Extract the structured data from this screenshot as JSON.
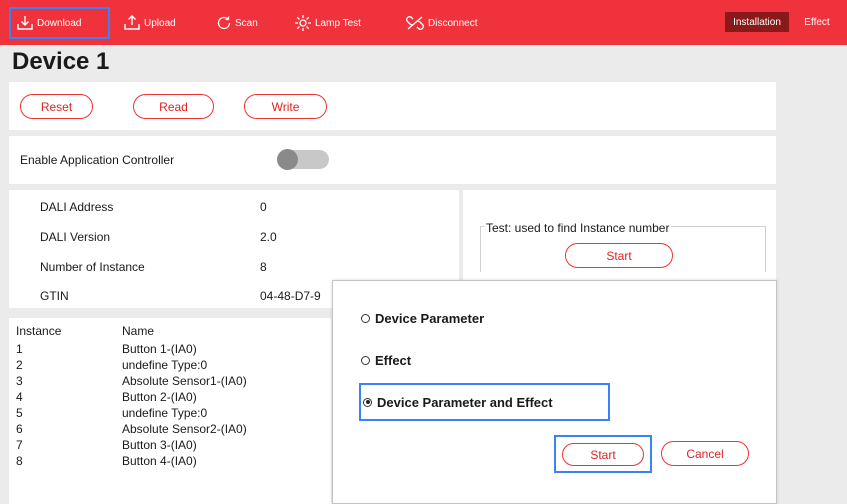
{
  "toolbar": {
    "download": "Download",
    "upload": "Upload",
    "scan": "Scan",
    "lamp_test": "Lamp Test",
    "disconnect": "Disconnect",
    "tabs": {
      "installation": "Installation",
      "effect": "Effect"
    },
    "active_tab": "Installation",
    "accent_color": "#f0323c"
  },
  "page": {
    "title": "Device 1"
  },
  "actions": {
    "reset": "Reset",
    "read": "Read",
    "write": "Write"
  },
  "controller": {
    "label": "Enable Application Controller",
    "enabled": false
  },
  "info": {
    "dali_address_label": "DALI Address",
    "dali_address": "0",
    "dali_version_label": "DALI Version",
    "dali_version": "2.0",
    "instances_label": "Number of Instance",
    "instances": "8",
    "gtin_label": "GTIN",
    "gtin": "04-48-D7-9"
  },
  "test": {
    "legend": "Test: used to find Instance number",
    "start": "Start"
  },
  "instances": {
    "headers": {
      "index": "Instance",
      "name": "Name"
    },
    "rows": [
      {
        "index": "1",
        "name": "Button 1-(IA0)"
      },
      {
        "index": "2",
        "name": "undefine Type:0"
      },
      {
        "index": "3",
        "name": "Absolute Sensor1-(IA0)"
      },
      {
        "index": "4",
        "name": "Button 2-(IA0)"
      },
      {
        "index": "5",
        "name": "undefine Type:0"
      },
      {
        "index": "6",
        "name": "Absolute Sensor2-(IA0)"
      },
      {
        "index": "7",
        "name": "Button 3-(IA0)"
      },
      {
        "index": "8",
        "name": "Button 4-(IA0)"
      }
    ]
  },
  "dialog": {
    "options": [
      "Device Parameter",
      "Effect",
      "Device Parameter and Effect"
    ],
    "selected_option": "Device Parameter and Effect",
    "start": "Start",
    "cancel": "Cancel"
  }
}
